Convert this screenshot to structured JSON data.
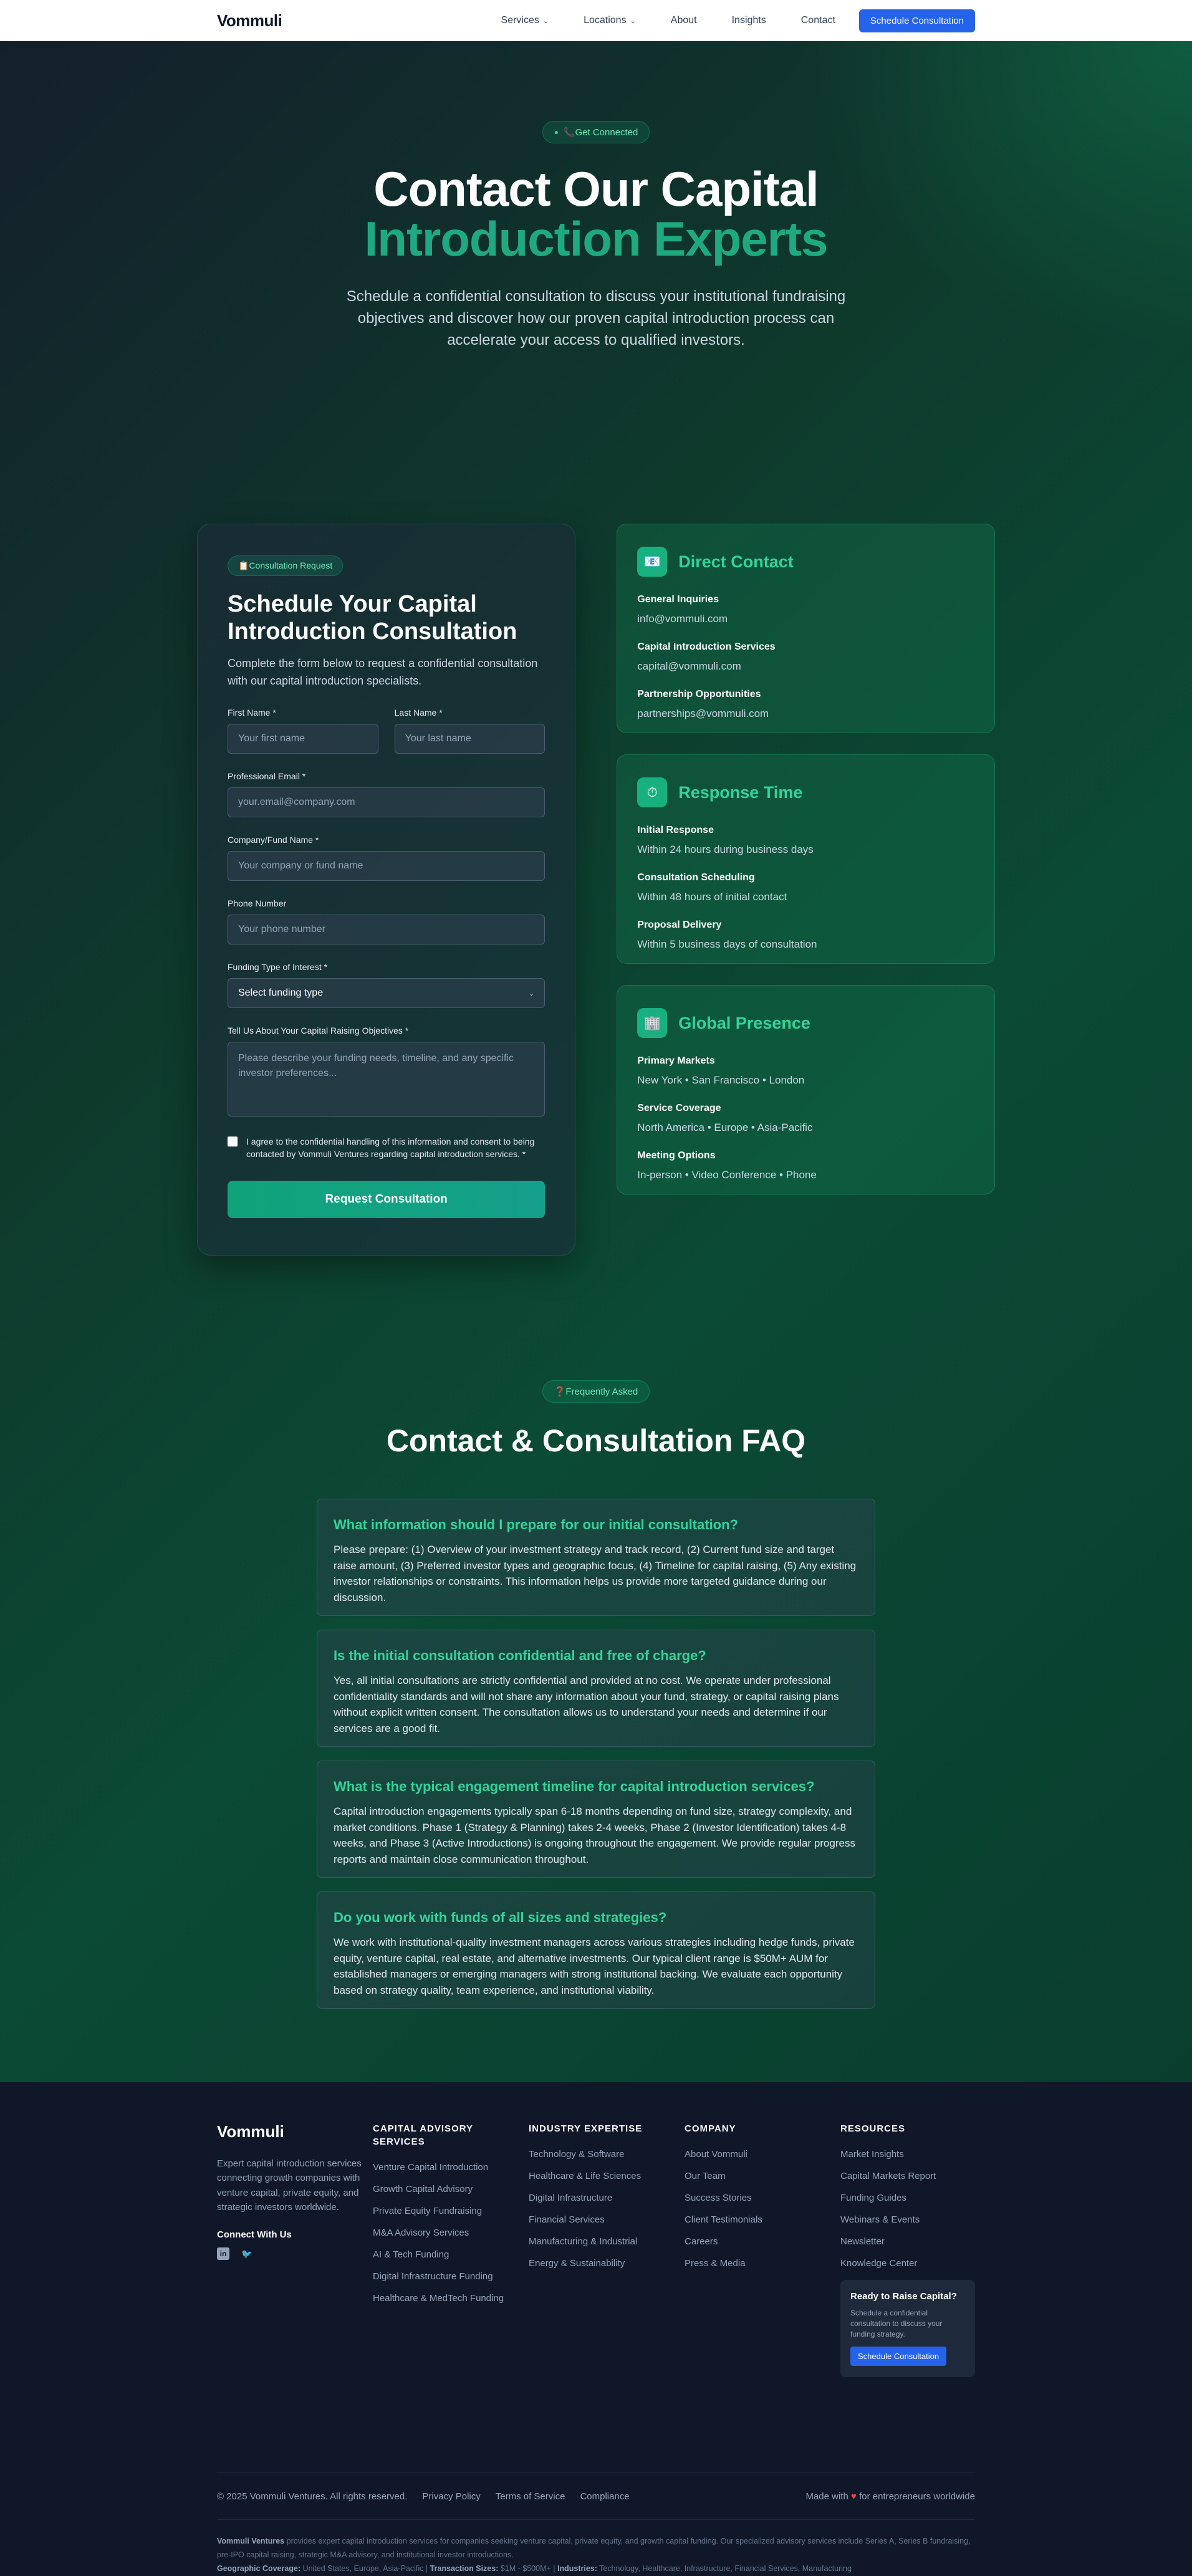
{
  "nav": {
    "brand": "Vommuli",
    "links": [
      {
        "label": "Services",
        "dropdown": true
      },
      {
        "label": "Locations",
        "dropdown": true
      },
      {
        "label": "About"
      },
      {
        "label": "Insights"
      },
      {
        "label": "Contact"
      }
    ],
    "cta": "Schedule Consultation"
  },
  "hero": {
    "badge": "📞Get Connected",
    "title_line1": "Contact Our Capital",
    "title_line2": "Introduction Experts",
    "subtitle": "Schedule a confidential consultation to discuss your institutional fundraising objectives and discover how our proven capital introduction process can accelerate your access to qualified investors."
  },
  "form": {
    "badge": "📋Consultation Request",
    "title": "Schedule Your Capital Introduction Consultation",
    "subtitle": "Complete the form below to request a confidential consultation with our capital introduction specialists.",
    "first_name": {
      "label": "First Name *",
      "placeholder": "Your first name"
    },
    "last_name": {
      "label": "Last Name *",
      "placeholder": "Your last name"
    },
    "email": {
      "label": "Professional Email *",
      "placeholder": "your.email@company.com"
    },
    "company": {
      "label": "Company/Fund Name *",
      "placeholder": "Your company or fund name"
    },
    "phone": {
      "label": "Phone Number",
      "placeholder": "Your phone number"
    },
    "funding_type": {
      "label": "Funding Type of Interest *",
      "value": "Select funding type"
    },
    "objectives": {
      "label": "Tell Us About Your Capital Raising Objectives *",
      "placeholder": "Please describe your funding needs, timeline, and any specific investor preferences..."
    },
    "consent": "I agree to the confidential handling of this information and consent to being contacted by Vommuli Ventures regarding capital introduction services. *",
    "submit": "Request Consultation"
  },
  "cards": [
    {
      "icon": "📧",
      "icon_name": "envelope-icon",
      "title": "Direct Contact",
      "items": [
        {
          "t": "General Inquiries",
          "v": "info@vommuli.com"
        },
        {
          "t": "Capital Introduction Services",
          "v": "capital@vommuli.com"
        },
        {
          "t": "Partnership Opportunities",
          "v": "partnerships@vommuli.com"
        }
      ]
    },
    {
      "icon": "⏱",
      "icon_name": "stopwatch-icon",
      "title": "Response Time",
      "items": [
        {
          "t": "Initial Response",
          "v": "Within 24 hours during business days"
        },
        {
          "t": "Consultation Scheduling",
          "v": "Within 48 hours of initial contact"
        },
        {
          "t": "Proposal Delivery",
          "v": "Within 5 business days of consultation"
        }
      ]
    },
    {
      "icon": "🏢",
      "icon_name": "building-icon",
      "title": "Global Presence",
      "items": [
        {
          "t": "Primary Markets",
          "v": "New York • San Francisco • London"
        },
        {
          "t": "Service Coverage",
          "v": "North America • Europe • Asia-Pacific"
        },
        {
          "t": "Meeting Options",
          "v": "In-person • Video Conference • Phone"
        }
      ]
    }
  ],
  "faq": {
    "badge": "❓Frequently Asked",
    "title": "Contact & Consultation FAQ",
    "items": [
      {
        "q": "What information should I prepare for our initial consultation?",
        "a": "Please prepare: (1) Overview of your investment strategy and track record, (2) Current fund size and target raise amount, (3) Preferred investor types and geographic focus, (4) Timeline for capital raising, (5) Any existing investor relationships or constraints. This information helps us provide more targeted guidance during our discussion."
      },
      {
        "q": "Is the initial consultation confidential and free of charge?",
        "a": "Yes, all initial consultations are strictly confidential and provided at no cost. We operate under professional confidentiality standards and will not share any information about your fund, strategy, or capital raising plans without explicit written consent. The consultation allows us to understand your needs and determine if our services are a good fit."
      },
      {
        "q": "What is the typical engagement timeline for capital introduction services?",
        "a": "Capital introduction engagements typically span 6-18 months depending on fund size, strategy complexity, and market conditions. Phase 1 (Strategy & Planning) takes 2-4 weeks, Phase 2 (Investor Identification) takes 4-8 weeks, and Phase 3 (Active Introductions) is ongoing throughout the engagement. We provide regular progress reports and maintain close communication throughout."
      },
      {
        "q": "Do you work with funds of all sizes and strategies?",
        "a": "We work with institutional-quality investment managers across various strategies including hedge funds, private equity, venture capital, real estate, and alternative investments. Our typical client range is $50M+ AUM for established managers or emerging managers with strong institutional backing. We evaluate each opportunity based on strategy quality, team experience, and institutional viability."
      }
    ]
  },
  "footer": {
    "brand": "Vommuli",
    "description": "Expert capital introduction services connecting growth companies with venture capital, private equity, and strategic investors worldwide.",
    "connect": "Connect With Us",
    "social": [
      "in",
      "🐦"
    ],
    "columns": [
      {
        "title": "CAPITAL ADVISORY SERVICES",
        "items": [
          "Venture Capital Introduction",
          "Growth Capital Advisory",
          "Private Equity Fundraising",
          "M&A Advisory Services",
          "AI & Tech Funding",
          "Digital Infrastructure Funding",
          "Healthcare & MedTech Funding"
        ]
      },
      {
        "title": "INDUSTRY EXPERTISE",
        "items": [
          "Technology & Software",
          "Healthcare & Life Sciences",
          "Digital Infrastructure",
          "Financial Services",
          "Manufacturing & Industrial",
          "Energy & Sustainability"
        ]
      },
      {
        "title": "COMPANY",
        "items": [
          "About Vommuli",
          "Our Team",
          "Success Stories",
          "Client Testimonials",
          "Careers",
          "Press & Media"
        ]
      },
      {
        "title": "RESOURCES",
        "items": [
          "Market Insights",
          "Capital Markets Report",
          "Funding Guides",
          "Webinars & Events",
          "Newsletter",
          "Knowledge Center"
        ]
      }
    ],
    "cta_box": {
      "title": "Ready to Raise Capital?",
      "desc": "Schedule a confidential consultation to discuss your funding strategy.",
      "button": "Schedule Consultation"
    },
    "copyright": "© 2025 Vommuli Ventures. All rights reserved.",
    "links": [
      "Privacy Policy",
      "Terms of Service",
      "Compliance"
    ],
    "made_prefix": "Made with",
    "made_heart": "♥",
    "made_suffix": "for entrepreneurs worldwide",
    "legal_name": "Vommuli Ventures",
    "legal_text": " provides expert capital introduction services for companies seeking venture capital, private equity, and growth capital funding. Our specialized advisory services include Series A, Series B fundraising, pre-IPO capital raising, strategic M&A advisory, and institutional investor introductions.",
    "geo_label": "Geographic Coverage:",
    "geo_value": " United States, Europe, Asia-Pacific | ",
    "size_label": "Transaction Sizes:",
    "size_value": " $1M - $500M+ | ",
    "ind_label": "Industries:",
    "ind_value": " Technology, Healthcare, Infrastructure, Financial Services, Manufacturing"
  }
}
